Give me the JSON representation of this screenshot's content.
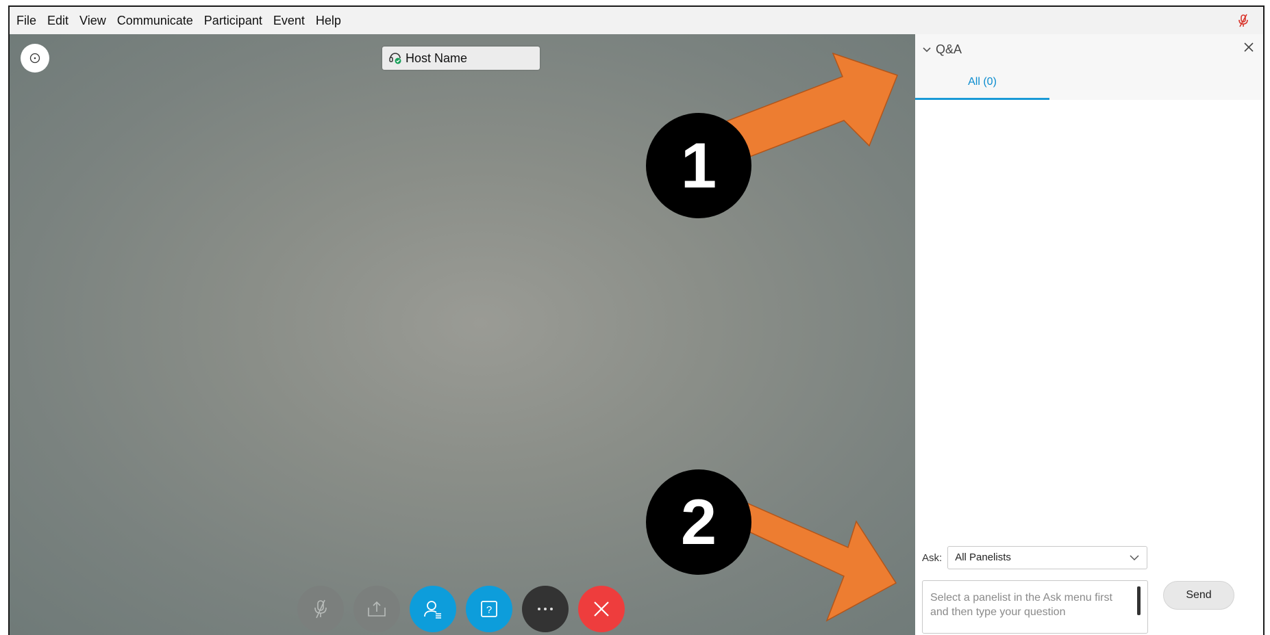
{
  "menu": {
    "items": [
      "File",
      "Edit",
      "View",
      "Communicate",
      "Participant",
      "Event",
      "Help"
    ]
  },
  "video": {
    "host_label": "Host Name"
  },
  "controls": {
    "icons": [
      "mute-microphone-icon",
      "share-content-icon",
      "participants-icon",
      "qa-icon",
      "more-options-icon",
      "leave-meeting-icon"
    ]
  },
  "annotations": {
    "badge_1": "1",
    "badge_2": "2",
    "arrow_color": "#ed7d31"
  },
  "qa_panel": {
    "title": "Q&A",
    "tab_all": "All (0)",
    "ask_label": "Ask:",
    "ask_selected": "All Panelists",
    "question_placeholder": "Select a panelist in the Ask menu first and then type your question",
    "send_label": "Send"
  },
  "colors": {
    "accent": "#0d9ddb",
    "leave_red": "#ee3d3d",
    "mute_red": "#d9342b"
  }
}
